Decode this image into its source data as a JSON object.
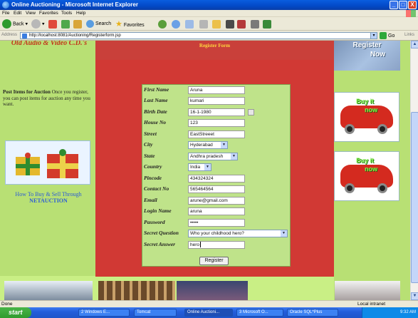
{
  "window": {
    "title": "Online Auctioning - Microsoft Internet Explorer",
    "min": "_",
    "max": "□",
    "close": "X"
  },
  "menu": [
    "File",
    "Edit",
    "View",
    "Favorites",
    "Tools",
    "Help"
  ],
  "toolbar": {
    "back": "Back",
    "search": "Search",
    "favorites": "Favorites"
  },
  "address": {
    "label": "Address",
    "url": "http://localhost:8081/Auctioning/Registerform.jsp",
    "go": "Go",
    "links": "Links"
  },
  "sidebar": {
    "site_title": "Old Audio & Video C.D.'s",
    "post_heading": "Post Items for Auction",
    "post_text": "Once you register, you can post items for auction any time you want.",
    "howto_line1": "How To Buy & Sell Through",
    "howto_line2": "NETAUCTION"
  },
  "form": {
    "title": "Register Form",
    "fields": [
      {
        "label": "First Name",
        "value": "Aruna"
      },
      {
        "label": "Last Name",
        "value": "kumari"
      },
      {
        "label": "Birth Date",
        "value": "16-1-1980"
      },
      {
        "label": "House No",
        "value": "123"
      },
      {
        "label": "Street",
        "value": "EastStreeet"
      },
      {
        "label": "City",
        "value": "Hyderabad"
      },
      {
        "label": "State",
        "value": "Andhra pradesh"
      },
      {
        "label": "Country",
        "value": "India"
      },
      {
        "label": "Pincode",
        "value": "434324324"
      },
      {
        "label": "Contact No",
        "value": "565464564"
      },
      {
        "label": "Email",
        "value": "arune@gmail.com"
      },
      {
        "label": "Login Name",
        "value": "aruna"
      },
      {
        "label": "Password",
        "value": "•••••"
      },
      {
        "label": "Secret Question",
        "value": "Who your childhood hero?"
      },
      {
        "label": "Secret Answer",
        "value": "hero"
      }
    ],
    "submit": "Register"
  },
  "rightbar": {
    "banner_line1": "Register",
    "banner_line2": "Now",
    "ad1_line1": "Buy it",
    "ad1_line2": "now",
    "ad2_line1": "Buy it",
    "ad2_line2": "now"
  },
  "status": {
    "left": "Done",
    "zone": "Local intranet"
  },
  "taskbar": {
    "start": "start",
    "tasks": [
      "2 Windows E...",
      "Tomcat",
      "Online Auctioni...",
      "3 Microsoft O...",
      "Oracle SQL*Plus"
    ],
    "clock": "9:32 AM"
  },
  "colors": {
    "page_bg": "#c9ef85",
    "form_bg": "#d13934",
    "form_title": "#ffd53e",
    "site_title": "#c3351b",
    "link_blue": "#2c5cd6"
  }
}
